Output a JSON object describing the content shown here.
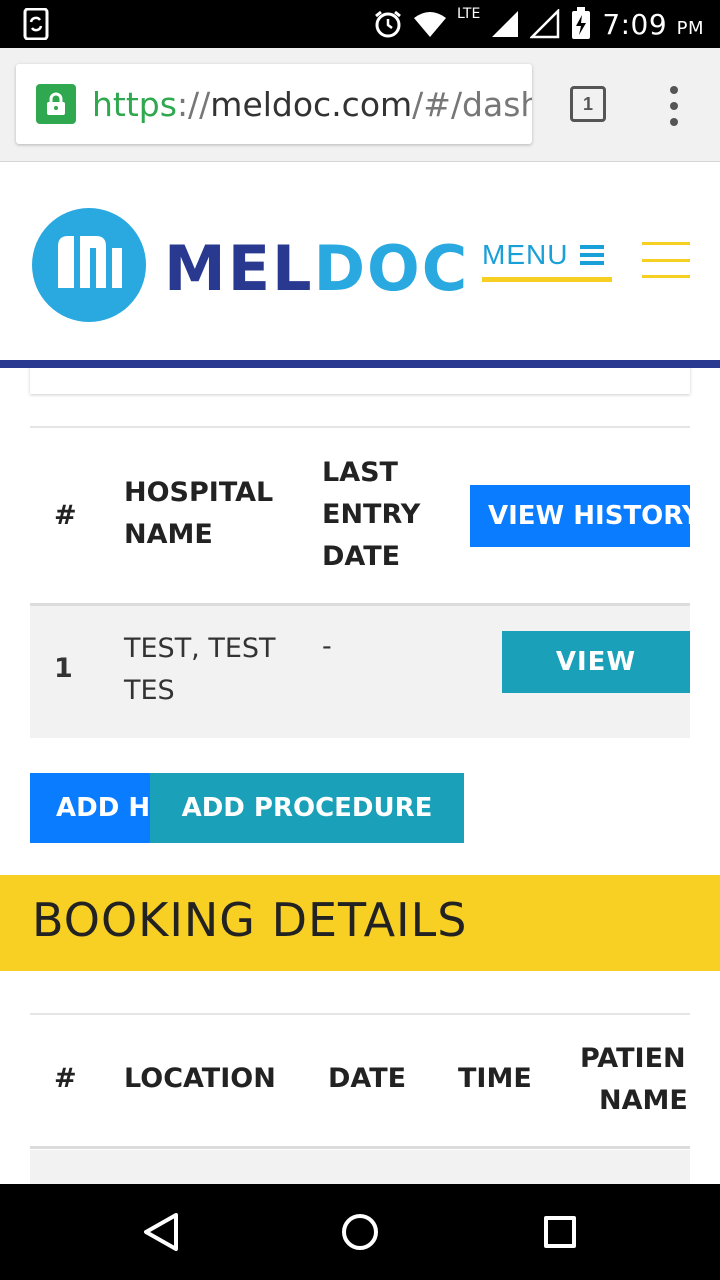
{
  "status_bar": {
    "network": "LTE",
    "time": "7:09",
    "ampm": "PM"
  },
  "browser": {
    "url_scheme": "https",
    "url_sep": "://",
    "url_host": "meldoc.com",
    "url_path": "/#/dash",
    "tab_count": "1"
  },
  "site": {
    "logo_part1": "MEL",
    "logo_part2": "DOC",
    "menu_label": "MENU"
  },
  "history_table": {
    "headers": {
      "num": "#",
      "hospital_line1": "HOSPITAL",
      "hospital_line2": "NAME",
      "last_line1": "LAST",
      "last_line2": "ENTRY",
      "last_line3": "DATE"
    },
    "view_history_label": "VIEW HISTORY",
    "rows": [
      {
        "num": "1",
        "hospital_line1": "TEST, TEST",
        "hospital_line2": "TES",
        "last_entry": "-",
        "view_label": "VIEW"
      }
    ]
  },
  "actions": {
    "add_h_label": "ADD H",
    "add_procedure_label": "ADD PROCEDURE"
  },
  "booking": {
    "title": "BOOKING DETAILS",
    "headers": {
      "num": "#",
      "location": "LOCATION",
      "date": "DATE",
      "time": "TIME",
      "patient_line1": "PATIEN",
      "patient_line2": "NAME"
    }
  },
  "colors": {
    "navy": "#2a3990",
    "cyan": "#1aa0d8",
    "yellow": "#f8cf23",
    "blue_button": "#0a7cff",
    "teal_button": "#1aa0b8"
  }
}
